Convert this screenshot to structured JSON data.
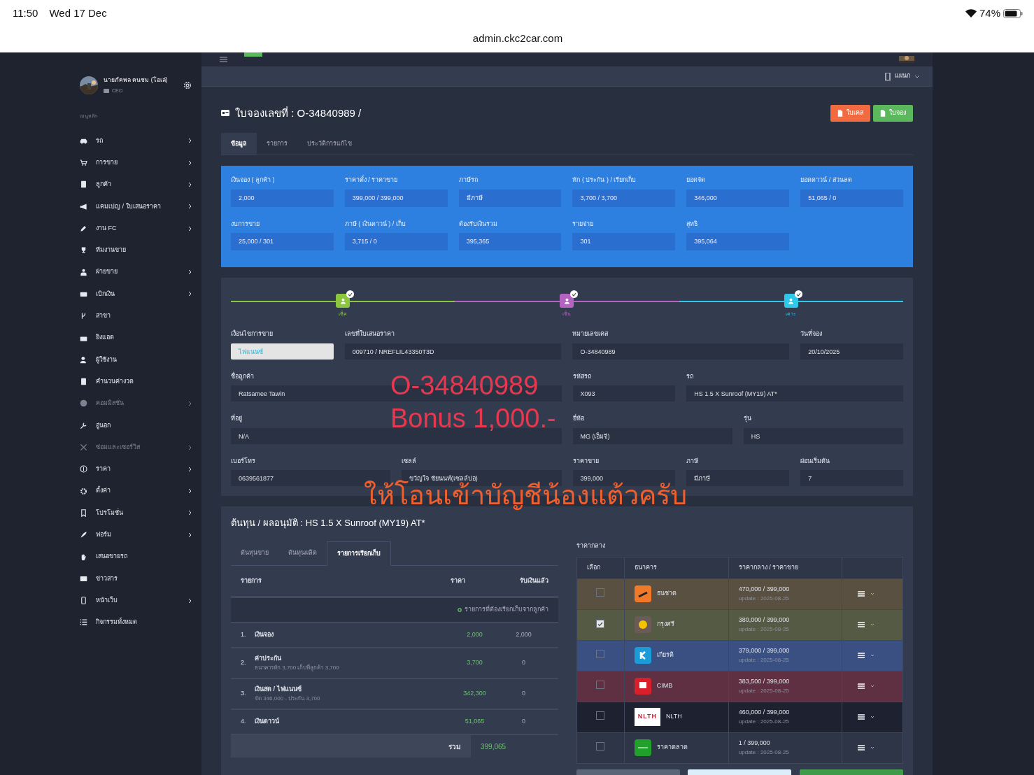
{
  "status_bar": {
    "time": "11:50",
    "date": "Wed 17 Dec",
    "battery": "74%",
    "url": "admin.ckc2car.com"
  },
  "header": {
    "department": "แผนก"
  },
  "sidebar": {
    "user": {
      "name": "นายภัคพล คนชม (โอเล่)",
      "role": "CEO"
    },
    "section": "เมนูหลัก",
    "items": [
      {
        "label": "รถ",
        "submenu": true,
        "disabled": false
      },
      {
        "label": "การขาย",
        "submenu": true,
        "disabled": false
      },
      {
        "label": "ลูกค้า",
        "submenu": true,
        "disabled": false
      },
      {
        "label": "แคมเปญ / ใบเสนอราคา",
        "submenu": true,
        "disabled": false
      },
      {
        "label": "งาน FC",
        "submenu": true,
        "disabled": false
      },
      {
        "label": "ทีมงานขาย",
        "submenu": false,
        "disabled": false
      },
      {
        "label": "ฝ่ายขาย",
        "submenu": true,
        "disabled": false
      },
      {
        "label": "เบิกเงิน",
        "submenu": true,
        "disabled": false
      },
      {
        "label": "สาขา",
        "submenu": false,
        "disabled": false
      },
      {
        "label": "ยิงแอด",
        "submenu": false,
        "disabled": false
      },
      {
        "label": "ผู้ใช้งาน",
        "submenu": false,
        "disabled": false
      },
      {
        "label": "คำนวนค่างวด",
        "submenu": false,
        "disabled": false
      },
      {
        "label": "คอมมิสชั่น",
        "submenu": true,
        "disabled": true
      },
      {
        "label": "อู่นอก",
        "submenu": false,
        "disabled": false
      },
      {
        "label": "ซ่อมและเซอร์วิส",
        "submenu": true,
        "disabled": true
      },
      {
        "label": "ราคา",
        "submenu": true,
        "disabled": false
      },
      {
        "label": "ตั้งค่า",
        "submenu": true,
        "disabled": false
      },
      {
        "label": "โปรโมชั่น",
        "submenu": true,
        "disabled": false
      },
      {
        "label": "ฟอร์ม",
        "submenu": true,
        "disabled": false
      },
      {
        "label": "เสนอขายรถ",
        "submenu": false,
        "disabled": false
      },
      {
        "label": "ข่าวสาร",
        "submenu": false,
        "disabled": false
      },
      {
        "label": "หน้าเว็บ",
        "submenu": true,
        "disabled": false
      },
      {
        "label": "กิจกรรมทั้งหมด",
        "submenu": false,
        "disabled": false
      }
    ]
  },
  "page": {
    "title": "ใบจองเลขที่ : O-34840989 /",
    "buttons": [
      {
        "label": "ใบเคส",
        "kind": "case"
      },
      {
        "label": "ใบจอง",
        "kind": "booking"
      }
    ],
    "tabs": [
      {
        "label": "ข้อมูล",
        "selected": true
      },
      {
        "label": "รายการ",
        "selected": false
      },
      {
        "label": "ประวัติการแก้ไข",
        "selected": false
      }
    ]
  },
  "summary": {
    "rows": [
      [
        {
          "label": "เงินจอง ( ลูกค้า )",
          "value": "2,000"
        },
        {
          "label": "ราคาตั้ง / ราคาขาย",
          "value": "399,000 / 399,000"
        },
        {
          "label": "ภาษีรถ",
          "value": "มีภาษี"
        },
        {
          "label": "หัก ( ประกัน ) / เรียกเก็บ",
          "value": "3,700 / 3,700"
        },
        {
          "label": "ยอดจัด",
          "value": "346,000"
        },
        {
          "label": "ยอดดาวน์ / ส่วนลด",
          "value": "51,065 / 0"
        }
      ],
      [
        {
          "label": "งบการขาย",
          "value": "25,000 / 301"
        },
        {
          "label": "ภาษี ( เงินดาวน์ ) / เก็บ",
          "value": "3,715 / 0"
        },
        {
          "label": "ต้องรับเงินรวม",
          "value": "395,365"
        },
        {
          "label": "รายจ่าย",
          "value": "301"
        },
        {
          "label": "สุทธิ",
          "value": "395,064"
        }
      ]
    ]
  },
  "steps": [
    {
      "label": "เช็ค",
      "color": "#8cc63f",
      "done": true
    },
    {
      "label": "เซ็น",
      "color": "#b563c0",
      "done": true
    },
    {
      "label": "เคาะ",
      "color": "#2ec8ea",
      "done": true
    }
  ],
  "form": {
    "fields": [
      {
        "label": "เงื่อนไขการขาย",
        "value": "ไฟแนนซ์",
        "kind": "select"
      },
      {
        "label": "เลขที่ใบเสนอราคา",
        "value": "009710 / NREFLIL43350T3D",
        "kind": "text"
      },
      {
        "label": "หมายเลขเคส",
        "value": "O-34840989",
        "kind": "text"
      },
      {
        "label": "วันที่จอง",
        "value": "20/10/2025",
        "kind": "text"
      },
      {
        "label": "ชื่อลูกค้า",
        "value": "Ratsamee Tawin",
        "kind": "text"
      },
      {
        "label": "รหัสรถ",
        "value": "X093",
        "kind": "text"
      },
      {
        "label": "รถ",
        "value": "HS 1.5 X Sunroof (MY19) AT*",
        "kind": "text"
      },
      {
        "label": "ที่อยู่",
        "value": "N/A",
        "kind": "text"
      },
      {
        "label": "ยี่ห้อ",
        "value": "MG (เอ็มจี)",
        "kind": "text"
      },
      {
        "label": "รุ่น",
        "value": "HS",
        "kind": "text"
      },
      {
        "label": "เบอร์โทร",
        "value": "0639561877",
        "kind": "text"
      },
      {
        "label": "เซลล์",
        "value": "ขวัญใจ  ชัยนนท์(เซลล์ปอ)",
        "kind": "text"
      },
      {
        "label": "ราคาขาย",
        "value": "399,000",
        "kind": "text"
      },
      {
        "label": "ภาษี",
        "value": "มีภาษี",
        "kind": "text"
      },
      {
        "label": "ผ่อนเริ่มต้น",
        "value": "7",
        "kind": "text"
      }
    ]
  },
  "annotations": [
    {
      "text": "O-34840989",
      "color": "#e8384f"
    },
    {
      "text": "Bonus 1,000.-",
      "color": "#e8384f"
    },
    {
      "text": "ให้โอนเข้าบัญชีน้องแต้วครับ",
      "color": "#f0602e"
    }
  ],
  "cost": {
    "title": "ต้นทุน / ผลอนุมัติ : HS 1.5 X Sunroof (MY19) AT*",
    "tabs": [
      {
        "label": "ต้นทุนขาย",
        "selected": false
      },
      {
        "label": "ต้นทุนผลิต",
        "selected": false
      },
      {
        "label": "รายการเรียกเก็บ",
        "selected": true
      }
    ],
    "columns": [
      "รายการ",
      "ราคา",
      "รับเงินแล้ว"
    ],
    "note": "รายการที่ต้องเรียกเก็บจากลูกค้า",
    "rows": [
      {
        "no": "1.",
        "title": "เงินจอง",
        "price": "2,000",
        "received": "2,000"
      },
      {
        "no": "2.",
        "title": "ค่าประกัน",
        "detail": "ธนาคารหัก 3,700 เก็บที่ลูกค้า 3,700",
        "price": "3,700",
        "received": "0"
      },
      {
        "no": "3.",
        "title": "เงินสด / ไฟแนนซ์",
        "detail": "จัด 346,000 - ประกัน 3,700",
        "price": "342,300",
        "received": "0"
      },
      {
        "no": "4.",
        "title": "เงินดาวน์",
        "price": "51,065",
        "received": "0"
      }
    ],
    "total": {
      "label": "รวม",
      "value": "399,065"
    }
  },
  "banks": {
    "title": "ราคากลาง",
    "columns": [
      "เลือก",
      "ธนาคาร",
      "ราคากลาง / ราคาขาย"
    ],
    "rows": [
      {
        "name": "ธนชาต",
        "price": "470,000 / 399,000",
        "update": "update : 2025-08-25",
        "checked": false,
        "color": "#595042"
      },
      {
        "name": "กรุงศรี",
        "price": "380,000 / 399,000",
        "update": "update : 2025-08-25",
        "checked": true,
        "color": "#555a45"
      },
      {
        "name": "เกียรติ",
        "price": "379,000 / 399,000",
        "update": "update : 2025-08-25",
        "checked": false,
        "color": "#3a5082"
      },
      {
        "name": "CIMB",
        "price": "383,500 / 399,000",
        "update": "update : 2025-08-25",
        "checked": false,
        "color": "#5e3042"
      },
      {
        "name": "NLTH",
        "logo_text": "NLTH",
        "price": "460,000 / 399,000",
        "update": "update : 2025-08-25",
        "checked": false,
        "color": "#1e2230"
      },
      {
        "name": "ราคาตลาด",
        "price": "1 / 399,000",
        "update": "update : 2025-08-25",
        "checked": false,
        "color": "#2e3547"
      }
    ]
  }
}
